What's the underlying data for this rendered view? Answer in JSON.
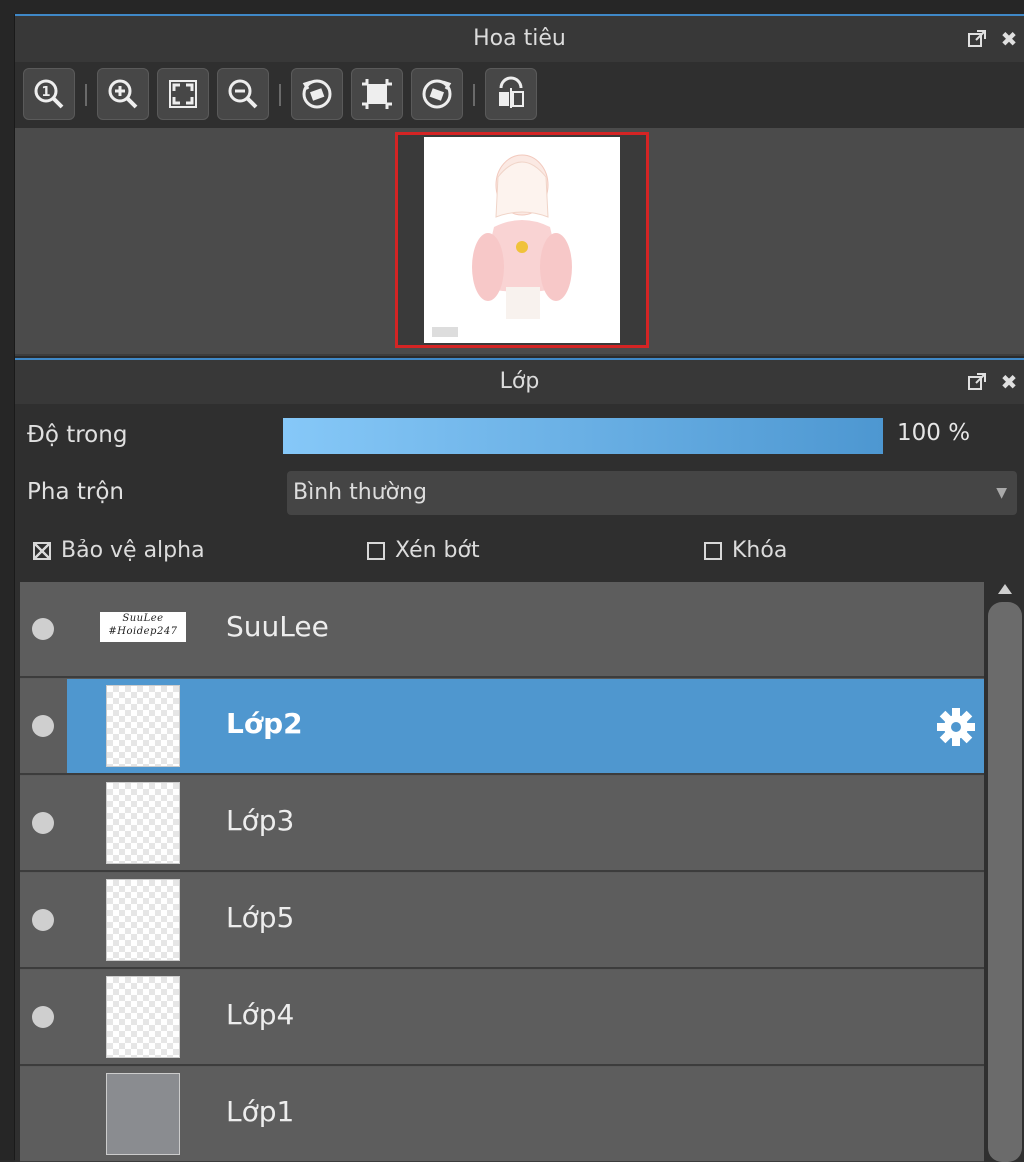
{
  "navigator": {
    "title": "Hoa tiêu",
    "toolbar_icons": [
      "zoom-actual-size-icon",
      "zoom-in-icon",
      "fit-to-window-icon",
      "zoom-out-icon",
      "rotate-left-icon",
      "reset-view-icon",
      "rotate-right-icon",
      "flip-horizontal-icon"
    ]
  },
  "layers_panel": {
    "title": "Lớp",
    "opacity_label": "Độ trong",
    "opacity_value": "100 %",
    "opacity_fraction": 1.0,
    "blend_label": "Pha trộn",
    "blend_value": "Bình thường",
    "protect_alpha": {
      "label": "Bảo vệ alpha",
      "checked": true
    },
    "clipping": {
      "label": "Xén bớt",
      "checked": false
    },
    "lock": {
      "label": "Khóa",
      "checked": false
    },
    "layers": [
      {
        "name": "SuuLee",
        "thumb_text": "SuuLee\n#Hoidep247",
        "visible": true,
        "selected": false
      },
      {
        "name": "Lớp2",
        "visible": true,
        "selected": true
      },
      {
        "name": "Lớp3",
        "visible": true,
        "selected": false
      },
      {
        "name": "Lớp5",
        "visible": true,
        "selected": false
      },
      {
        "name": "Lớp4",
        "visible": true,
        "selected": false
      },
      {
        "name": "Lớp1",
        "visible": false,
        "selected": false
      }
    ]
  },
  "colors": {
    "accent": "#4f97cf",
    "thumbnail_border": "#d42424"
  }
}
